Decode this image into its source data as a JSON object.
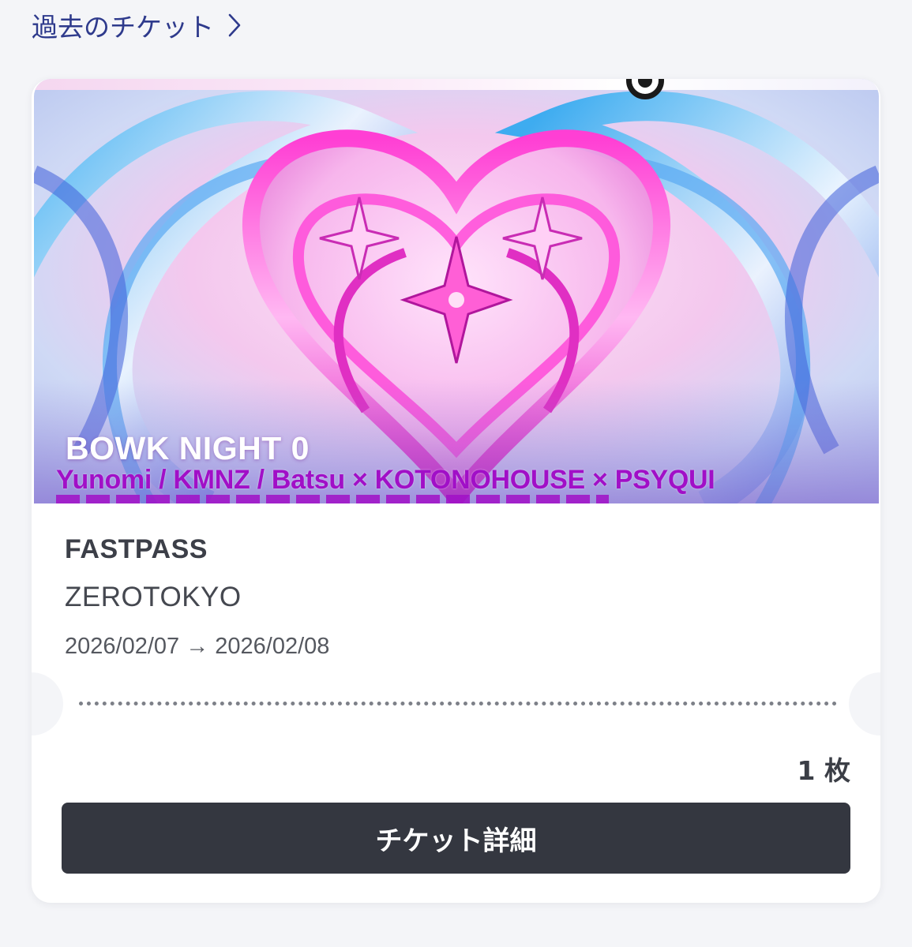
{
  "header": {
    "past_tickets_label": "過去のチケット"
  },
  "ticket": {
    "event_title": "BOWK NIGHT 0",
    "lineup": "Yunomi / KMNZ / Batsu × KOTONOHOUSE × PSYQUI",
    "pass_name": "FASTPASS",
    "venue": "ZEROTOKYO",
    "dates": "2026/02/07 → 2026/02/08",
    "quantity": "1 枚",
    "detail_button_label": "チケット詳細"
  },
  "colors": {
    "link": "#2e3a8c",
    "button_bg": "#343740",
    "lineup_text": "#a10fc7",
    "page_bg": "#f4f5f8"
  },
  "icons": {
    "past_tickets_chevron": "chevron-right-icon",
    "banner_brand": "brand-logo-icon"
  }
}
